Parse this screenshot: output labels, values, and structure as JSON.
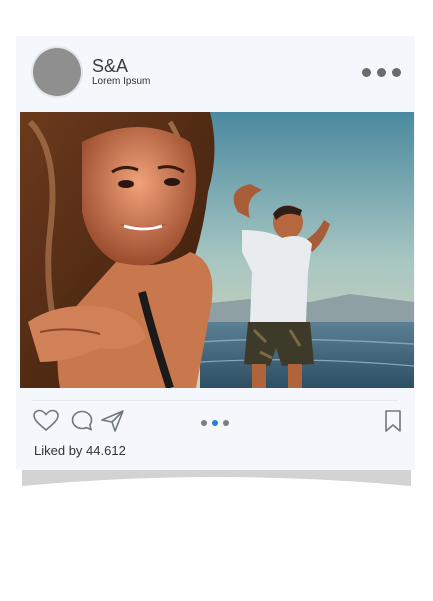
{
  "post": {
    "user_name": "S&A",
    "user_subtitle": "Lorem Ipsum",
    "likes_text": "Liked by 44.612",
    "carousel": {
      "count": 3,
      "active_index": 1
    }
  },
  "icons": {
    "more": "more-dots-icon",
    "like": "heart-icon",
    "comment": "comment-bubble-icon",
    "share": "send-arrow-icon",
    "save": "bookmark-icon"
  },
  "colors": {
    "card_bg": "#f4f8fd",
    "active_dot": "#2b7cd3",
    "icon_stroke": "#6f7780"
  }
}
